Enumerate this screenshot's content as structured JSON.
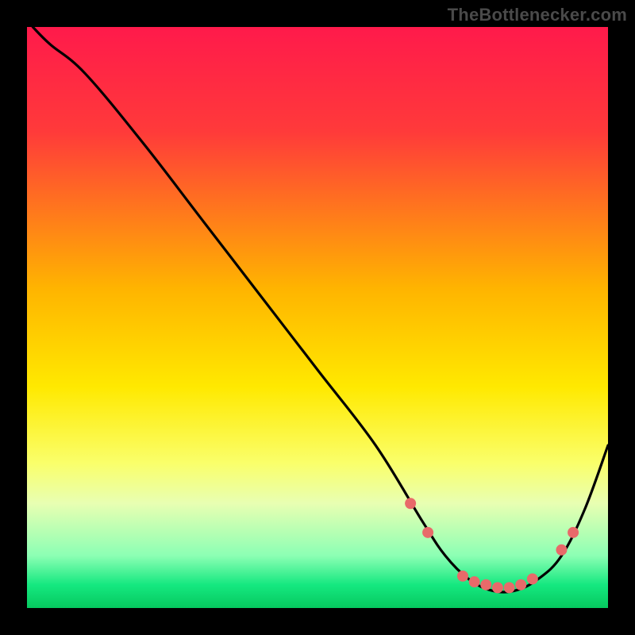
{
  "attribution": "TheBottlenecker.com",
  "chart_data": {
    "type": "line",
    "title": "",
    "xlabel": "",
    "ylabel": "",
    "xlim": [
      0,
      100
    ],
    "ylim": [
      0,
      100
    ],
    "gradient_stops": [
      {
        "offset": 0,
        "color": "#ff1a4b"
      },
      {
        "offset": 18,
        "color": "#ff3a3a"
      },
      {
        "offset": 45,
        "color": "#ffb400"
      },
      {
        "offset": 62,
        "color": "#ffe900"
      },
      {
        "offset": 75,
        "color": "#faff6a"
      },
      {
        "offset": 82,
        "color": "#e8ffb2"
      },
      {
        "offset": 91,
        "color": "#8cffb4"
      },
      {
        "offset": 96,
        "color": "#15e880"
      },
      {
        "offset": 100,
        "color": "#06c95f"
      }
    ],
    "series": [
      {
        "name": "bottleneck-curve",
        "x": [
          1,
          4,
          10,
          20,
          30,
          40,
          50,
          60,
          68,
          72,
          76,
          80,
          84,
          88,
          92,
          96,
          100
        ],
        "y": [
          100,
          97,
          92,
          80,
          67,
          54,
          41,
          28,
          15,
          9,
          5,
          3,
          3,
          5,
          9,
          17,
          28
        ]
      }
    ],
    "markers": {
      "name": "highlight-dots",
      "color": "#e86a6a",
      "radius": 7,
      "points": [
        {
          "x": 66,
          "y": 18
        },
        {
          "x": 69,
          "y": 13
        },
        {
          "x": 75,
          "y": 5.5
        },
        {
          "x": 77,
          "y": 4.5
        },
        {
          "x": 79,
          "y": 4
        },
        {
          "x": 81,
          "y": 3.5
        },
        {
          "x": 83,
          "y": 3.5
        },
        {
          "x": 85,
          "y": 4
        },
        {
          "x": 87,
          "y": 5
        },
        {
          "x": 92,
          "y": 10
        },
        {
          "x": 94,
          "y": 13
        }
      ]
    }
  }
}
